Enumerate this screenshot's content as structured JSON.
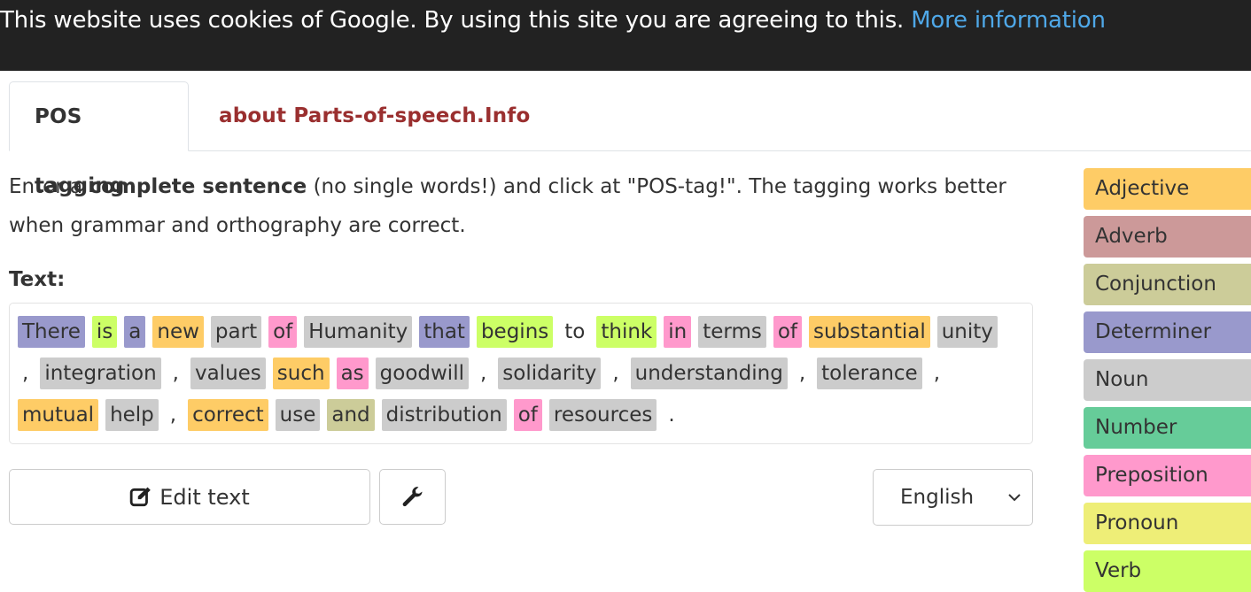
{
  "cookie": {
    "text": "This website uses cookies of Google. By using this site you are agreeing to this.",
    "link": "More information"
  },
  "tabs": [
    {
      "label": "POS tagging",
      "active": true
    },
    {
      "label": "about Parts-of-speech.Info",
      "active": false
    }
  ],
  "intro": {
    "pre": "Enter a ",
    "bold": "complete sentence",
    "post": " (no single words!) and click at \"POS-tag!\". The tagging works better when grammar and orthography are correct."
  },
  "text_label": "Text:",
  "colors": {
    "Adjective": "#fecc66",
    "Adverb": "#cc9999",
    "Conjunction": "#cccc99",
    "Determiner": "#9999cc",
    "Noun": "#cccccc",
    "Number": "#66cc99",
    "Preposition": "#ff99cc",
    "Pronoun": "#eeee77",
    "Verb": "#ccff66",
    "None": "transparent"
  },
  "tokens": [
    {
      "w": "There",
      "t": "Determiner"
    },
    {
      "w": "is",
      "t": "Verb"
    },
    {
      "w": "a",
      "t": "Determiner"
    },
    {
      "w": "new",
      "t": "Adjective"
    },
    {
      "w": "part",
      "t": "Noun"
    },
    {
      "w": "of",
      "t": "Preposition"
    },
    {
      "w": "Humanity",
      "t": "Noun"
    },
    {
      "w": "that",
      "t": "Determiner"
    },
    {
      "w": "begins",
      "t": "Verb"
    },
    {
      "w": "to",
      "t": "None"
    },
    {
      "w": "think",
      "t": "Verb"
    },
    {
      "w": "in",
      "t": "Preposition"
    },
    {
      "w": "terms",
      "t": "Noun"
    },
    {
      "w": "of",
      "t": "Preposition"
    },
    {
      "w": "substantial",
      "t": "Adjective"
    },
    {
      "w": "unity",
      "t": "Noun"
    },
    {
      "w": ",",
      "t": "None"
    },
    {
      "w": "integration",
      "t": "Noun"
    },
    {
      "w": ",",
      "t": "None"
    },
    {
      "w": "values",
      "t": "Noun"
    },
    {
      "w": "such",
      "t": "Adjective"
    },
    {
      "w": "as",
      "t": "Preposition"
    },
    {
      "w": "goodwill",
      "t": "Noun"
    },
    {
      "w": ",",
      "t": "None"
    },
    {
      "w": "solidarity",
      "t": "Noun"
    },
    {
      "w": ",",
      "t": "None"
    },
    {
      "w": "understanding",
      "t": "Noun"
    },
    {
      "w": ",",
      "t": "None"
    },
    {
      "w": "tolerance",
      "t": "Noun"
    },
    {
      "w": ",",
      "t": "None"
    },
    {
      "w": "mutual",
      "t": "Adjective"
    },
    {
      "w": "help",
      "t": "Noun"
    },
    {
      "w": ",",
      "t": "None"
    },
    {
      "w": "correct",
      "t": "Adjective"
    },
    {
      "w": "use",
      "t": "Noun"
    },
    {
      "w": "and",
      "t": "Conjunction"
    },
    {
      "w": "distribution",
      "t": "Noun"
    },
    {
      "w": "of",
      "t": "Preposition"
    },
    {
      "w": "resources",
      "t": "Noun"
    },
    {
      "w": ".",
      "t": "None"
    }
  ],
  "buttons": {
    "edit_label": "Edit text",
    "edit_icon": "edit-icon",
    "settings_icon": "wrench-icon"
  },
  "language": {
    "selected": "English"
  },
  "legend": [
    "Adjective",
    "Adverb",
    "Conjunction",
    "Determiner",
    "Noun",
    "Number",
    "Preposition",
    "Pronoun",
    "Verb"
  ]
}
